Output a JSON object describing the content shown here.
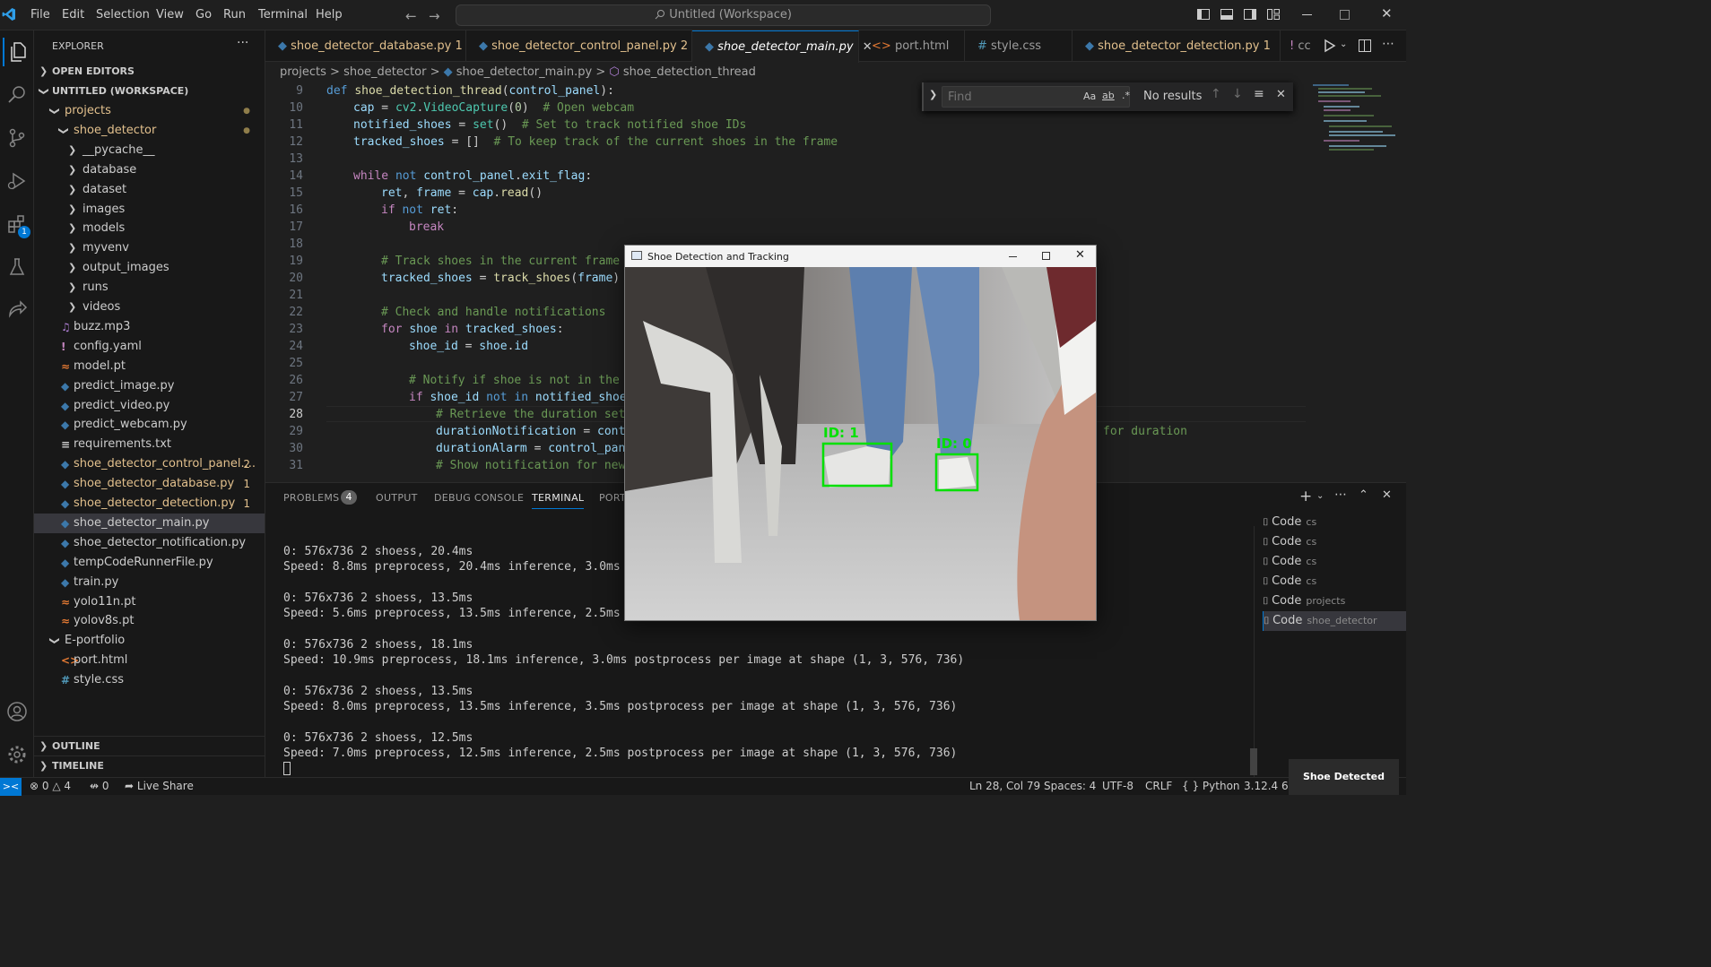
{
  "menu": [
    "File",
    "Edit",
    "Selection",
    "View",
    "Go",
    "Run",
    "Terminal",
    "Help"
  ],
  "command_center": "Untitled (Workspace)",
  "explorer": {
    "title": "EXPLORER",
    "more": "···",
    "open_editors": "OPEN EDITORS",
    "workspace": "UNTITLED (WORKSPACE)",
    "items": [
      {
        "label": "projects",
        "badge": "●"
      },
      {
        "label": "shoe_detector",
        "badge": "●"
      },
      {
        "label": "__pycache__"
      },
      {
        "label": "database"
      },
      {
        "label": "dataset"
      },
      {
        "label": "images"
      },
      {
        "label": "models"
      },
      {
        "label": "myvenv"
      },
      {
        "label": "output_images"
      },
      {
        "label": "runs"
      },
      {
        "label": "videos"
      },
      {
        "label": "buzz.mp3"
      },
      {
        "label": "config.yaml"
      },
      {
        "label": "model.pt"
      },
      {
        "label": "predict_image.py"
      },
      {
        "label": "predict_video.py"
      },
      {
        "label": "predict_webcam.py"
      },
      {
        "label": "requirements.txt"
      },
      {
        "label": "shoe_detector_control_panel....",
        "badge": "2"
      },
      {
        "label": "shoe_detector_database.py",
        "badge": "1"
      },
      {
        "label": "shoe_detector_detection.py",
        "badge": "1"
      },
      {
        "label": "shoe_detector_main.py"
      },
      {
        "label": "shoe_detector_notification.py"
      },
      {
        "label": "tempCodeRunnerFile.py"
      },
      {
        "label": "train.py"
      },
      {
        "label": "yolo11n.pt"
      },
      {
        "label": "yolov8s.pt"
      },
      {
        "label": "E-portfolio"
      },
      {
        "label": "port.html"
      },
      {
        "label": "style.css"
      }
    ],
    "outline": "OUTLINE",
    "timeline": "TIMELINE"
  },
  "tabs": [
    {
      "label": "shoe_detector_database.py",
      "badge": "1"
    },
    {
      "label": "shoe_detector_control_panel.py",
      "badge": "2"
    },
    {
      "label": "shoe_detector_main.py",
      "badge": ""
    },
    {
      "label": "port.html",
      "badge": ""
    },
    {
      "label": "style.css",
      "badge": ""
    },
    {
      "label": "shoe_detector_detection.py",
      "badge": "1"
    },
    {
      "label": "cc",
      "badge": ""
    }
  ],
  "breadcrumb": {
    "a": "projects",
    "b": "shoe_detector",
    "c": "shoe_detector_main.py",
    "d": "shoe_detection_thread",
    "sep": ">"
  },
  "code": {
    "line_numbers": [
      "9",
      "10",
      "11",
      "12",
      "13",
      "14",
      "15",
      "16",
      "17",
      "18",
      "19",
      "20",
      "21",
      "22",
      "23",
      "24",
      "25",
      "26",
      "27",
      "28",
      "29",
      "30",
      "31"
    ],
    "l9": [
      "def",
      "shoe_detection_thread",
      "(",
      "control_panel",
      "):"
    ],
    "l10": [
      "cap",
      " = ",
      "cv2",
      ".",
      "VideoCapture",
      "(",
      "0",
      ")",
      "  # Open webcam"
    ],
    "l11": [
      "notified_shoes",
      " = ",
      "set",
      "()",
      "  # Set to track notified shoe IDs"
    ],
    "l12": [
      "tracked_shoes",
      " = []",
      "  # To keep track of the current shoes in the frame"
    ],
    "l14": [
      "while",
      "not",
      "control_panel",
      ".",
      "exit_flag",
      ":"
    ],
    "l15": [
      "ret",
      ", ",
      "frame",
      " = ",
      "cap",
      ".",
      "read",
      "()"
    ],
    "l16": [
      "if",
      "not",
      "ret",
      ":"
    ],
    "l17": [
      "break"
    ],
    "l19": "# Track shoes in the current frame",
    "l20": [
      "tracked_shoes",
      " = ",
      "track_shoes",
      "(",
      "frame",
      ")"
    ],
    "l22": "# Check and handle notifications",
    "l23": [
      "for",
      "shoe",
      "in",
      "tracked_shoes",
      ":"
    ],
    "l24": [
      "shoe_id",
      " = ",
      "shoe",
      ".",
      "id"
    ],
    "l26": "# Notify if shoe is not in the n",
    "l27": [
      "if",
      "shoe_id",
      "not in",
      "notified_shoes"
    ],
    "l28": "# Retrieve the duration set",
    "l29": [
      "durationNotification",
      " = ",
      "contr"
    ],
    "l29_tail": "for duration",
    "l30": [
      "durationAlarm",
      " = ",
      "control_pane"
    ],
    "l31": "# Show notification for new"
  },
  "find": {
    "placeholder": "Find",
    "aa": "Aa",
    "ab": "ab",
    "star": ".*",
    "result": "No results"
  },
  "panel": {
    "tabs": [
      "PROBLEMS",
      "OUTPUT",
      "DEBUG CONSOLE",
      "TERMINAL",
      "PORTS"
    ],
    "problems_count": "4",
    "terminal_lines": [
      "0: 576x736 2 shoess, 20.4ms",
      "Speed: 8.8ms preprocess, 20.4ms inference, 3.0ms pos",
      "",
      "0: 576x736 2 shoess, 13.5ms",
      "Speed: 5.6ms preprocess, 13.5ms inference, 2.5ms pos",
      "",
      "0: 576x736 2 shoess, 18.1ms",
      "Speed: 10.9ms preprocess, 18.1ms inference, 3.0ms postprocess per image at shape (1, 3, 576, 736)",
      "",
      "0: 576x736 2 shoess, 13.5ms",
      "Speed: 8.0ms preprocess, 13.5ms inference, 3.5ms postprocess per image at shape (1, 3, 576, 736)",
      "",
      "0: 576x736 2 shoess, 12.5ms",
      "Speed: 7.0ms preprocess, 12.5ms inference, 2.5ms postprocess per image at shape (1, 3, 576, 736)"
    ],
    "terminals": [
      {
        "name": "Code",
        "sub": "cs"
      },
      {
        "name": "Code",
        "sub": "cs"
      },
      {
        "name": "Code",
        "sub": "cs"
      },
      {
        "name": "Code",
        "sub": "cs"
      },
      {
        "name": "Code",
        "sub": "projects"
      },
      {
        "name": "Code",
        "sub": "shoe_detector"
      }
    ]
  },
  "popup": {
    "title": "Shoe Detection and Tracking",
    "box1": "ID: 1",
    "box2": "ID: 0",
    "box_color": "#00e000"
  },
  "status": {
    "errors": "0",
    "warnings": "4",
    "ports": "0",
    "live_share": "Live Share",
    "position": "Ln 28, Col 79",
    "spaces": "Spaces: 4",
    "encoding": "UTF-8",
    "eol": "CRLF",
    "language": "Python",
    "interpreter": "3.12.4 64-",
    "brackets": "{ }"
  },
  "toast": "Shoe Detected",
  "colors": {
    "accent": "#0078d4",
    "modified": "#e2c08d",
    "error": "#f14c4c",
    "python": "#3c78aa",
    "html": "#e37933"
  }
}
